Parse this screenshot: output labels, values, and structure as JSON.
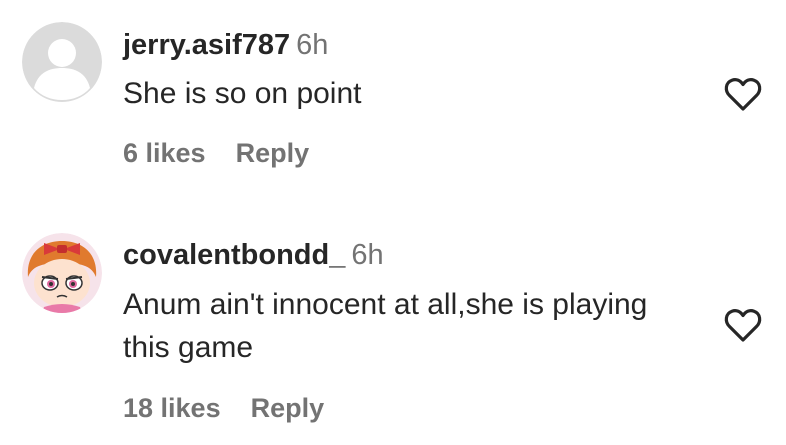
{
  "comments": [
    {
      "username": "jerry.asif787",
      "time": "6h",
      "text": "She is so on point",
      "likes": "6 likes",
      "reply": "Reply",
      "avatar": "default-avatar-icon"
    },
    {
      "username": "covalentbondd_",
      "time": "6h",
      "text": "Anum ain't innocent at all,she is playing this game",
      "likes": "18 likes",
      "reply": "Reply",
      "avatar": "cartoon-girl-avatar"
    }
  ],
  "colors": {
    "primary_text": "#262626",
    "secondary_text": "#737373",
    "default_avatar_bg": "#dbdbdb"
  },
  "icons": {
    "like": "heart-outline-icon"
  }
}
